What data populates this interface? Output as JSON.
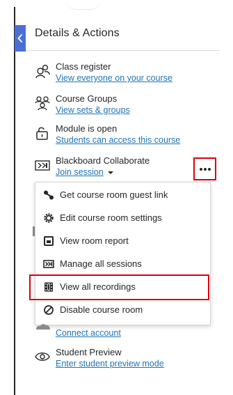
{
  "panel": {
    "title": "Details & Actions"
  },
  "rows": {
    "class_register": {
      "title": "Class register",
      "link": "View everyone on your course",
      "icon": "users-icon"
    },
    "course_groups": {
      "title": "Course Groups",
      "link": "View sets & groups",
      "icon": "groups-icon"
    },
    "module_status": {
      "title": "Module is open",
      "link": "Students can access this course",
      "icon": "unlock-icon"
    },
    "collaborate": {
      "title": "Blackboard Collaborate",
      "link": "Join session",
      "icon": "collaborate-icon"
    },
    "cloud": {
      "link": "Connect account",
      "icon": "cloud-icon"
    },
    "preview": {
      "title": "Student Preview",
      "link": "Enter student preview mode",
      "icon": "eye-icon"
    }
  },
  "menu": {
    "items": [
      {
        "label": "Get course room guest link",
        "icon": "link-icon"
      },
      {
        "label": "Edit course room settings",
        "icon": "gear-icon"
      },
      {
        "label": "View room report",
        "icon": "report-icon"
      },
      {
        "label": "Manage all sessions",
        "icon": "sessions-icon"
      },
      {
        "label": "View all recordings",
        "icon": "recordings-icon",
        "highlighted": true
      },
      {
        "label": "Disable course room",
        "icon": "disable-icon"
      }
    ]
  },
  "colors": {
    "accent_blue": "#4a6fd9",
    "link": "#1f74b8",
    "highlight_red": "#d9000d",
    "text": "#262626"
  }
}
